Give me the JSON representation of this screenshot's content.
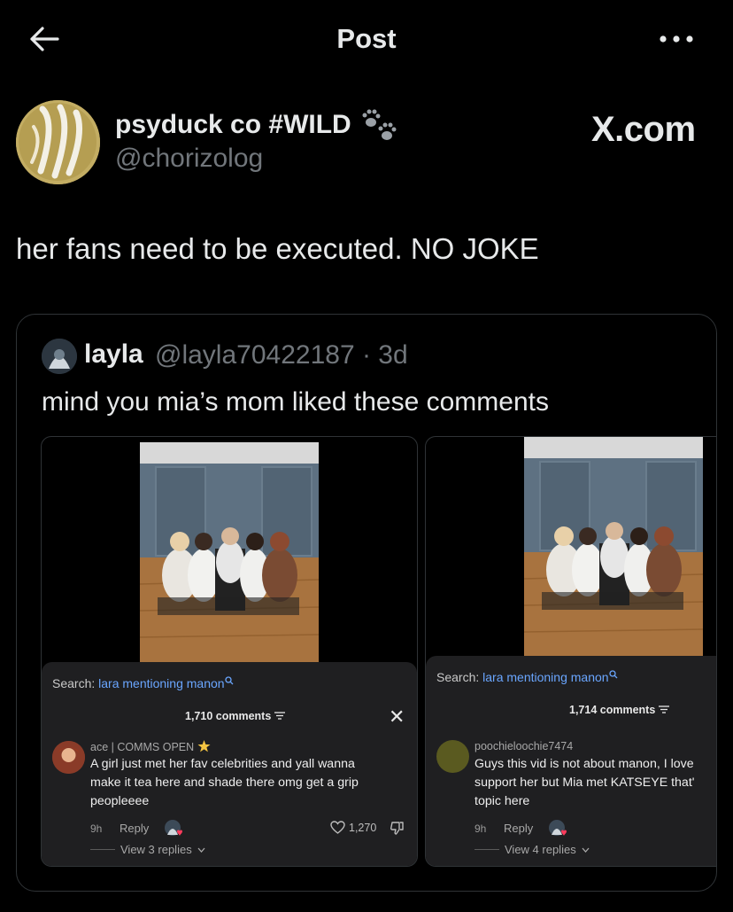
{
  "header": {
    "title": "Post"
  },
  "author": {
    "name": "psyduck co #WILD",
    "handle": "@chorizolog",
    "emoji_icon": "paw-prints-icon"
  },
  "watermark": "X.com",
  "tweet": {
    "text": "her fans need to be executed. NO JOKE"
  },
  "quote": {
    "name": "layla",
    "handle_time": "@layla70422187 · 3d",
    "text": "mind you mia’s mom liked these comments",
    "media": [
      {
        "search_label": "Search:",
        "search_link": "lara mentioning manon",
        "comments_count": "1,710 comments",
        "comment": {
          "user": "ace | COMMS OPEN",
          "lines": [
            "A girl just met her fav celebrities and yall wanna",
            "make it tea here and shade there omg get a grip",
            "peopleeee"
          ],
          "time": "9h",
          "reply": "Reply",
          "likes": "1,270",
          "view_replies": "View 3 replies"
        }
      },
      {
        "search_label": "Search:",
        "search_link": "lara mentioning manon",
        "comments_count": "1,714 comments",
        "comment": {
          "user": "poochieloochie7474",
          "lines": [
            "Guys this vid is not about manon, I love",
            "support her but Mia met KATSEYE that'",
            "topic here"
          ],
          "time": "9h",
          "reply": "Reply",
          "view_replies": "View 4 replies"
        }
      }
    ]
  },
  "colors": {
    "background": "#000000",
    "text_primary": "#e7e9ea",
    "text_secondary": "#71767b",
    "border": "#2f3336",
    "link_blue": "#6aa6ff",
    "panel": "#1f1f21"
  }
}
